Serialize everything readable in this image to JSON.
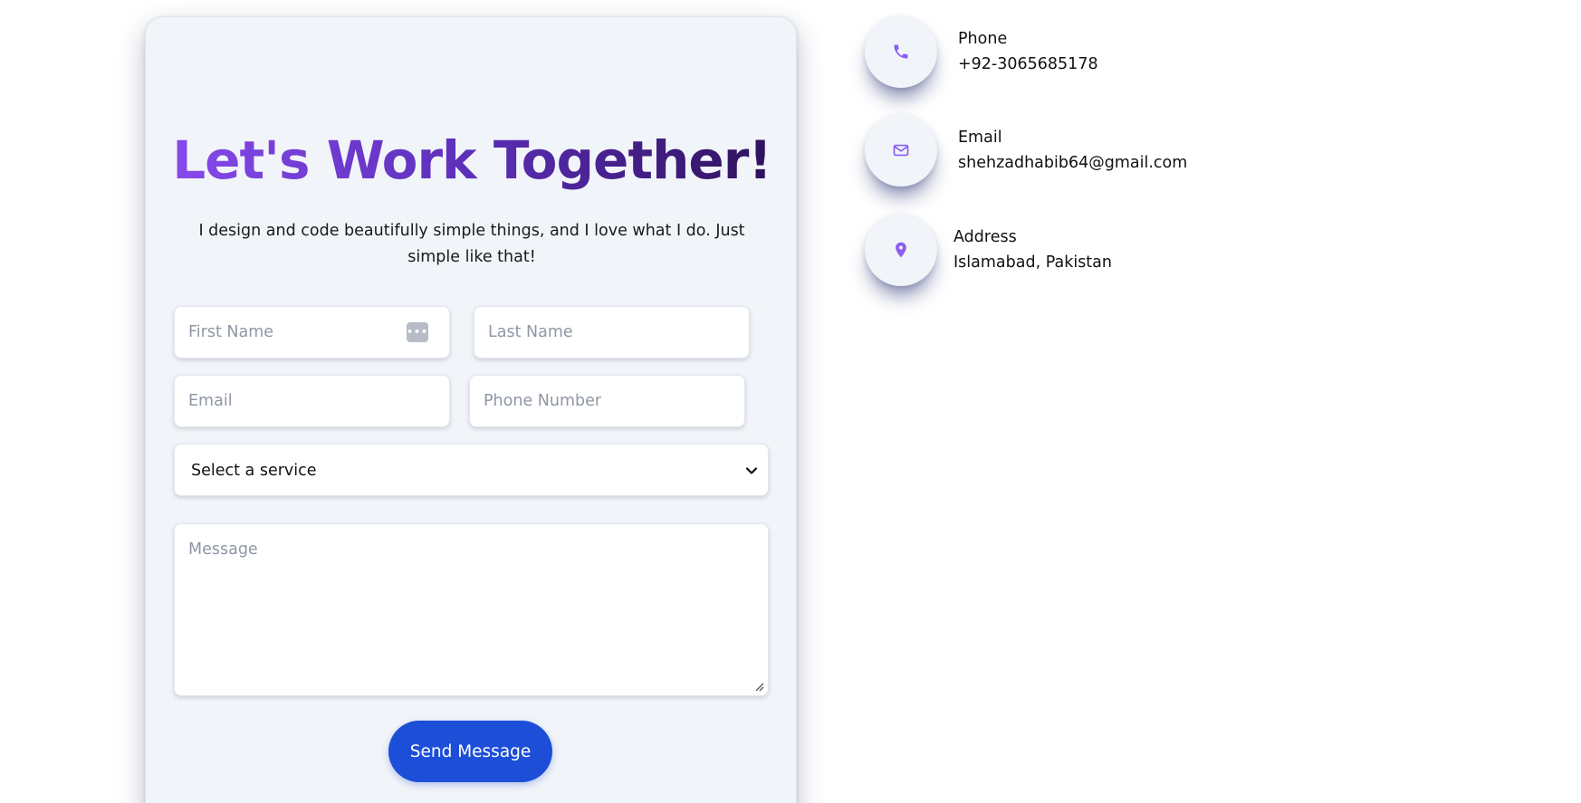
{
  "form": {
    "title": "Let's Work Together!",
    "subtitle": "I design and code beautifully simple things, and I love what I do. Just simple like that!",
    "first_name_placeholder": "First Name",
    "last_name_placeholder": "Last Name",
    "email_placeholder": "Email",
    "phone_placeholder": "Phone Number",
    "service_select_value": "Select a service",
    "message_placeholder": "Message",
    "send_label": "Send Message"
  },
  "contact": {
    "phone": {
      "label": "Phone",
      "value": "+92-3065685178",
      "icon": "phone-icon"
    },
    "email": {
      "label": "Email",
      "value": "shehzadhabib64@gmail.com",
      "icon": "mail-icon"
    },
    "address": {
      "label": "Address",
      "value": "Islamabad, Pakistan",
      "icon": "map-pin-icon"
    }
  },
  "colors": {
    "accent": "#8b5cf6",
    "button": "#1d4ed8",
    "card_background": "#f1f4f8",
    "title_gradient": [
      "#8a4bf0",
      "#2a0f55"
    ]
  }
}
